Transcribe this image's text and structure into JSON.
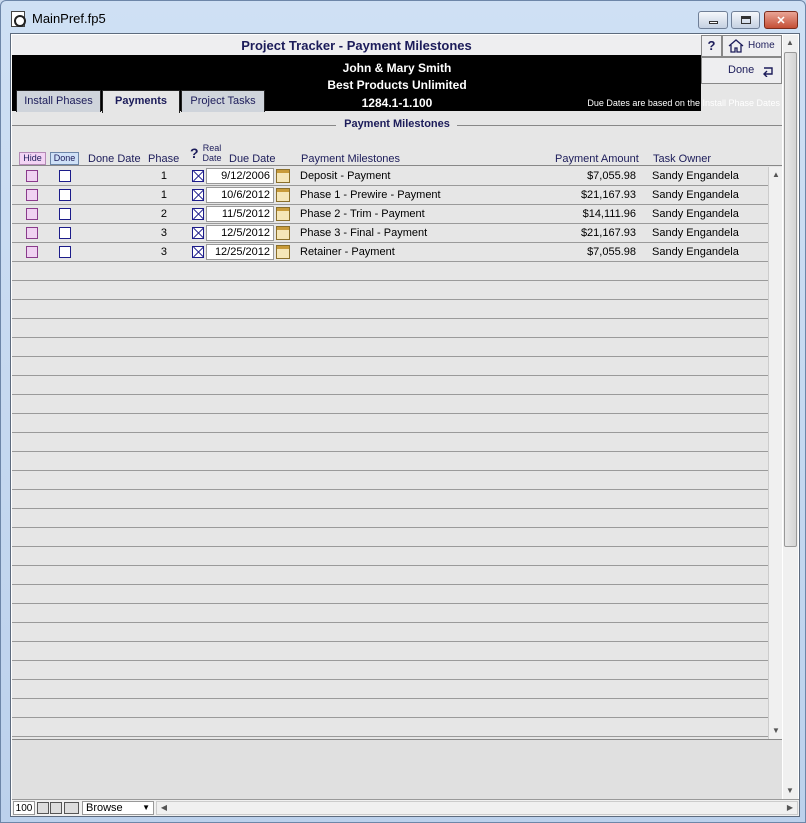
{
  "window": {
    "title": "MainPref.fp5"
  },
  "header": {
    "title": "Project Tracker - Payment Milestones",
    "client": "John & Mary Smith",
    "company": "Best Products Unlimited",
    "project_no": "1284.1-1.100",
    "due_note": "Due Dates are based on the Install Phase Dates",
    "help_label": "?",
    "home_label": "Home",
    "done_label": "Done"
  },
  "tabs": [
    {
      "label": "Install Phases"
    },
    {
      "label": "Payments",
      "active": true
    },
    {
      "label": "Project Tasks"
    }
  ],
  "section": {
    "title": "Payment Milestones"
  },
  "columns": {
    "hide": "Hide",
    "done": "Done",
    "done_date": "Done Date",
    "phase": "Phase",
    "real_q": "?",
    "real_date": "Real Date",
    "due_date": "Due Date",
    "milestones": "Payment Milestones",
    "amount": "Payment Amount",
    "owner": "Task Owner"
  },
  "rows": [
    {
      "phase": "1",
      "due_date": "9/12/2006",
      "milestone": "Deposit - Payment",
      "amount": "$7,055.98",
      "owner": "Sandy Engandela"
    },
    {
      "phase": "1",
      "due_date": "10/6/2012",
      "milestone": "Phase 1 - Prewire - Payment",
      "amount": "$21,167.93",
      "owner": "Sandy Engandela"
    },
    {
      "phase": "2",
      "due_date": "11/5/2012",
      "milestone": "Phase 2 - Trim - Payment",
      "amount": "$14,111.96",
      "owner": "Sandy Engandela"
    },
    {
      "phase": "3",
      "due_date": "12/5/2012",
      "milestone": "Phase 3 - Final - Payment",
      "amount": "$21,167.93",
      "owner": "Sandy Engandela"
    },
    {
      "phase": "3",
      "due_date": "12/25/2012",
      "milestone": "Retainer - Payment",
      "amount": "$7,055.98",
      "owner": "Sandy Engandela"
    }
  ],
  "empty_rows": 25,
  "statusbar": {
    "zoom": "100",
    "mode": "Browse"
  }
}
